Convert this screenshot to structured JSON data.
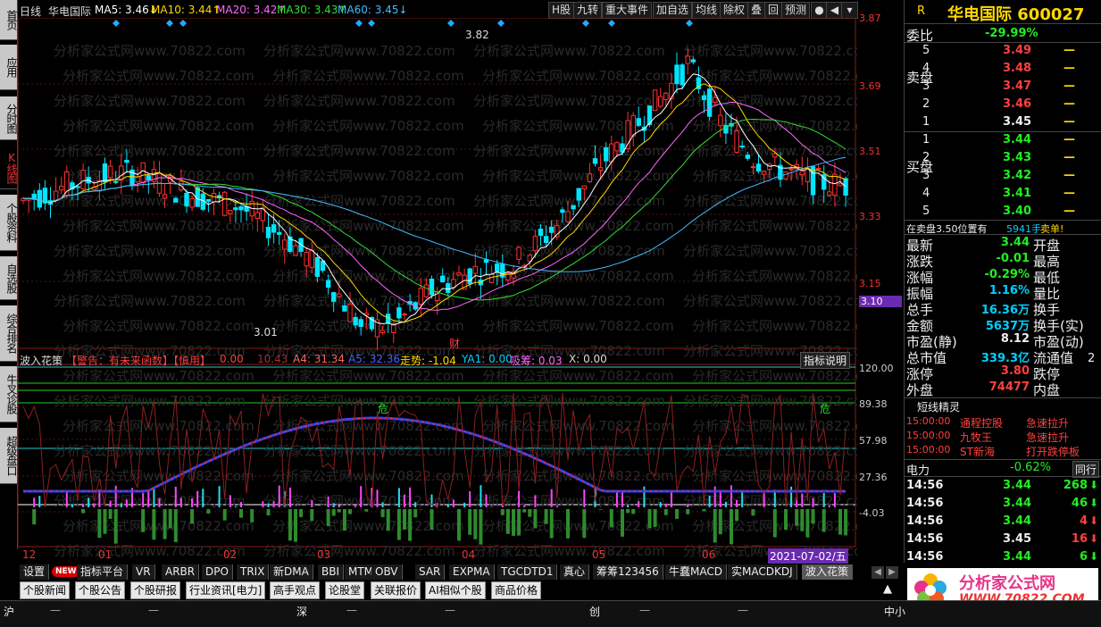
{
  "left_tabs": [
    "首页",
    "应用",
    "分时图",
    "K线图",
    "个股资料",
    "自选股",
    "综合排名",
    "牛叉诊股",
    "超级盘口"
  ],
  "chart_header": {
    "period": "日线",
    "stock_name": "华电国际",
    "ma5": "MA5: 3.46↓",
    "ma10": "MA10: 3.44↑",
    "ma20": "MA20: 3.42↑",
    "ma30": "MA30: 3.43↑",
    "ma60": "MA60: 3.45↓"
  },
  "toolbar": [
    "H股",
    "九转",
    "重大事件",
    "加自选",
    "均线",
    "除权",
    "叠",
    "回",
    "预测"
  ],
  "watermark": "分析家公式网www.70822.com",
  "price_axis": [
    "3.87",
    "3.69",
    "3.51",
    "3.33",
    "3.15",
    "3.10"
  ],
  "high_marker": "3.82",
  "low_marker": "3.01",
  "cai_marker": "财",
  "indicator_header": {
    "name": "波入花策",
    "warn": "【警告：有未来函数】【慎用】",
    "v1": "0.00",
    "v2": "10.43",
    "a4": "A4: 31.34",
    "a5": "A5: 32.36",
    "trend": "走势: -1.04",
    "ya1": "YA1: 0.00",
    "xc": "吸筹: 0.03",
    "x": "X: 0.00",
    "help": "指标说明"
  },
  "indicator_axis": [
    "120.00",
    "89.38",
    "57.98",
    "27.36",
    "-4.03"
  ],
  "danger_label": "危",
  "month_labels": [
    "12",
    "01",
    "02",
    "03",
    "04",
    "05",
    "06"
  ],
  "current_date": "2021-07-02/五",
  "right": {
    "r_label": "R",
    "title": "华电国际 600027",
    "weibi_label": "委比",
    "weibi_value": "-29.99%",
    "sell_label": "卖盘",
    "buy_label": "买盘",
    "sell": [
      {
        "lvl": "5",
        "price": "3.49",
        "vol": "—"
      },
      {
        "lvl": "4",
        "price": "3.48",
        "vol": "—"
      },
      {
        "lvl": "3",
        "price": "3.47",
        "vol": "—"
      },
      {
        "lvl": "2",
        "price": "3.46",
        "vol": "—"
      },
      {
        "lvl": "1",
        "price": "3.45",
        "vol": "—"
      }
    ],
    "buy": [
      {
        "lvl": "1",
        "price": "3.44",
        "vol": "—"
      },
      {
        "lvl": "2",
        "price": "3.43",
        "vol": "—"
      },
      {
        "lvl": "3",
        "price": "3.42",
        "vol": "—"
      },
      {
        "lvl": "4",
        "price": "3.41",
        "vol": "—"
      },
      {
        "lvl": "5",
        "price": "3.40",
        "vol": "—"
      }
    ],
    "notice_a": "在卖盘3.50位置有",
    "notice_b": "5941手",
    "notice_c": "卖单!",
    "stats": [
      {
        "k": "最新",
        "v": "3.44",
        "k2": "开盘"
      },
      {
        "k": "涨跌",
        "v": "-0.01",
        "k2": "最高"
      },
      {
        "k": "涨幅",
        "v": "-0.29%",
        "k2": "最低"
      },
      {
        "k": "振幅",
        "v": "1.16%",
        "k2": "量比"
      },
      {
        "k": "总手",
        "v": "16.36万",
        "k2": "换手"
      },
      {
        "k": "金额",
        "v": "5637万",
        "k2": "换手(实)"
      },
      {
        "k": "市盈(静)",
        "v": "8.12",
        "k2": "市盈(动)"
      },
      {
        "k": "总市值",
        "v": "339.3亿",
        "k2": "流通值"
      },
      {
        "k": "涨停",
        "v": "3.80",
        "k2": "跌停"
      },
      {
        "k": "外盘",
        "v": "74477",
        "k2": "内盘"
      }
    ],
    "extra_2": "2",
    "sprite_title": "短线精灵",
    "sprite": [
      {
        "time": "15:00:00",
        "name": "通程控股",
        "event": "急速拉升"
      },
      {
        "time": "15:00:00",
        "name": "九牧王",
        "event": "急速拉升"
      },
      {
        "time": "15:00:00",
        "name": "ST新海",
        "event": "打开跌停板"
      }
    ],
    "sector": "电力",
    "sector_pct": "-0.62%",
    "tonghang": "同行",
    "ticks": [
      {
        "t": "14:56",
        "p": "3.44",
        "v": "268",
        "dir": "down"
      },
      {
        "t": "14:56",
        "p": "3.44",
        "v": "46",
        "dir": "down"
      },
      {
        "t": "14:56",
        "p": "3.44",
        "v": "4",
        "dir": "up"
      },
      {
        "t": "14:56",
        "p": "3.45",
        "v": "16",
        "dir": "up"
      },
      {
        "t": "14:56",
        "p": "3.44",
        "v": "6",
        "dir": "down"
      }
    ]
  },
  "indicator_tabs": [
    "设置",
    "NEW",
    "指标平台",
    "VR",
    "ARBR",
    "DPO",
    "TRIX",
    "新DMA",
    "BBI",
    "MTM",
    "OBV",
    "SAR",
    "EXPMA",
    "TGCDTD1",
    "真心",
    "筹筹123456",
    "牛蠢MACD",
    "实MACDKDJ",
    "波入花策"
  ],
  "news_tabs": [
    "个股新闻",
    "个股公告",
    "个股研报",
    "行业资讯[电力]",
    "高手观点",
    "论股堂",
    "关联报价",
    "AI相似个股",
    "商品价格"
  ],
  "status": {
    "sh": "沪",
    "sz": "深",
    "cy": "创",
    "zxb": "中小",
    "dash": "—"
  },
  "logo": {
    "title": "分析家公式网",
    "url": "WWW.70822.COM"
  }
}
